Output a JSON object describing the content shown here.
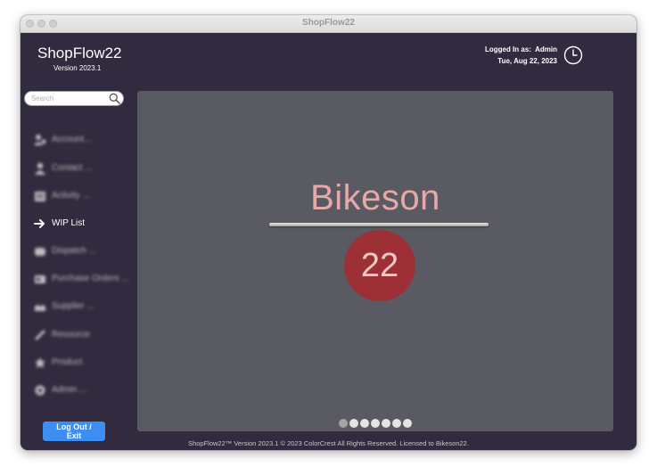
{
  "window": {
    "title": "ShopFlow22"
  },
  "header": {
    "app_name": "ShopFlow22",
    "version": "Version 2023.1",
    "login_label": "Logged In as:",
    "login_user": "Admin",
    "date": "Tue, Aug 22, 2023"
  },
  "search": {
    "placeholder": "Search",
    "value": ""
  },
  "sidebar": {
    "items": [
      {
        "label": "Account...",
        "icon": "account-icon"
      },
      {
        "label": "Contact ...",
        "icon": "contact-icon"
      },
      {
        "label": "Activity ...",
        "icon": "activity-icon"
      },
      {
        "label": "WIP List",
        "icon": "arrow-right-icon"
      },
      {
        "label": "Dispatch ...",
        "icon": "dispatch-icon"
      },
      {
        "label": "Purchase Orders ...",
        "icon": "purchase-orders-icon"
      },
      {
        "label": "Supplier ...",
        "icon": "supplier-icon"
      },
      {
        "label": "Resource",
        "icon": "resource-icon"
      },
      {
        "label": "Product",
        "icon": "product-icon"
      },
      {
        "label": "Admin ...",
        "icon": "admin-gear-icon"
      }
    ],
    "logout_label": "Log Out / Exit"
  },
  "main": {
    "brand": "Bikeson",
    "badge": "22",
    "carousel": {
      "count": 7,
      "active_index": 1
    }
  },
  "footer": {
    "text": "ShopFlow22™ Version 2023.1     © 2023 ColorCrest  All Rights Reserved.  Licensed to Bikeson22."
  },
  "colors": {
    "background": "#322a3e",
    "panel": "#5a5a62",
    "brand_text": "#e6a8a8",
    "badge": "#9c3034",
    "button": "#3c8ef3"
  }
}
